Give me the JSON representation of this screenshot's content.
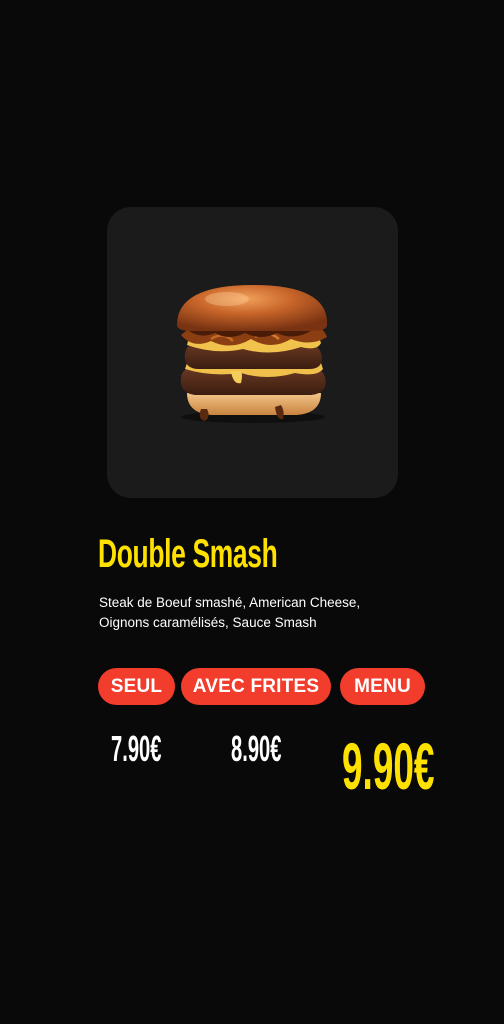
{
  "product": {
    "name": "Double Smash",
    "description": "Steak de Boeuf smashé, American Cheese, Oignons caramélisés, Sauce Smash",
    "image": "burger-photo"
  },
  "options": [
    {
      "label": "SEUL",
      "price": "7.90€"
    },
    {
      "label": "AVEC FRITES",
      "price": "8.90€"
    },
    {
      "label": "MENU",
      "price": "9.90€"
    }
  ],
  "colors": {
    "background": "#090909",
    "card": "#1b1b1b",
    "accent_yellow": "#ffe100",
    "pill_red": "#f23d2c",
    "text_white": "#ffffff"
  }
}
